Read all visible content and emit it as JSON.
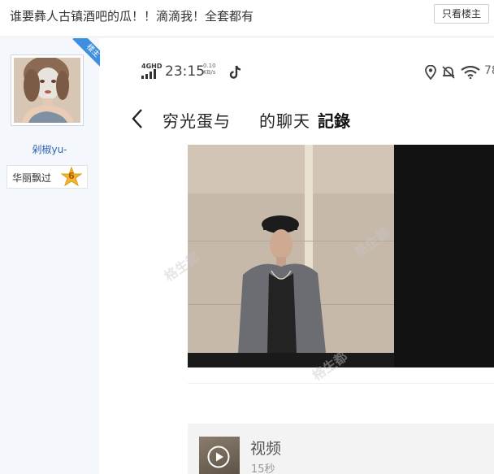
{
  "thread": {
    "title": "谁要彝人古镇酒吧的瓜！！滴滴我！全套都有",
    "only_op_button": "只看楼主"
  },
  "author": {
    "op_badge": "楼主",
    "username": "剁椒yu-",
    "level_name": "华丽飘过",
    "level_number": "6"
  },
  "screenshot": {
    "status_bar": {
      "network": "4GHD",
      "time": "23:15",
      "speed_value": "0.10",
      "speed_unit": "KB/s",
      "battery": "78"
    },
    "chat_header": {
      "title_part1": "穷光蛋与",
      "title_part2": "的聊天",
      "title_part3": "記錄"
    },
    "video": {
      "label": "视频",
      "duration": "15秒"
    },
    "watermark_text": "格生都"
  },
  "icons": {
    "back": "chevron-left-icon",
    "tiktok": "tiktok-icon",
    "location": "location-pin-icon",
    "mute": "bell-mute-icon",
    "wifi": "wifi-icon",
    "play": "play-icon",
    "signal": "signal-bars-icon",
    "level": "star-badge-icon"
  },
  "colors": {
    "username": "#2d64b3",
    "op_ribbon": "#3f8fe0",
    "sidebar_bg": "#f4f7fb",
    "level_badge": "#f2b630"
  }
}
